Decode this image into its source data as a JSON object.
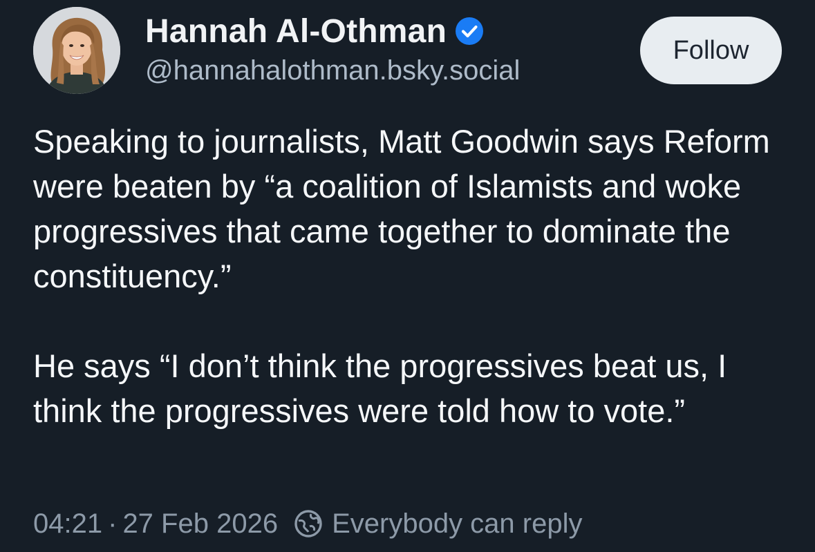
{
  "author": {
    "display_name": "Hannah Al-Othman",
    "handle": "@hannahalothman.bsky.social",
    "verified_icon": "verified-badge-icon"
  },
  "follow_button": {
    "label": "Follow"
  },
  "post": {
    "paragraphs": [
      "Speaking to journalists, Matt Goodwin says Reform were beaten by “a coalition of Islamists and woke progressives that came together to dominate the constituency.”",
      "He says “I don’t think the progressives beat us, I think the progressives were told how to vote.”"
    ]
  },
  "meta": {
    "time": "04:21",
    "separator": "·",
    "date": "27 Feb 2026",
    "reply_setting": "Everybody can reply",
    "reply_icon": "globe-reply-icon"
  },
  "colors": {
    "background": "#161e27",
    "verified": "#1a7cf5",
    "follow_button_bg": "#e8edf1",
    "muted_text": "#8d9aa8"
  }
}
